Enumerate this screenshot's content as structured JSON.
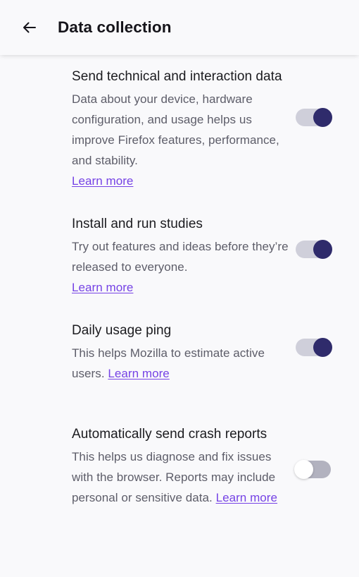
{
  "header": {
    "back_icon": "arrow-left-icon",
    "title": "Data collection"
  },
  "colors": {
    "background": "#f9f9fb",
    "title_text": "#15141a",
    "heading_text": "#1b1b1f",
    "body_text": "#5d5d69",
    "link": "#7542e5",
    "toggle_on_thumb": "#2f2b6b",
    "toggle_on_track": "#cfcfda",
    "toggle_off_thumb": "#ffffff",
    "toggle_off_track": "#b2b2bf"
  },
  "preferences": [
    {
      "title": "Send technical and interaction data",
      "description": "Data about your device, hardware configuration, and usage helps us improve Firefox features, performance, and stability.",
      "link_label": "Learn more",
      "link_inline": false,
      "toggle_state": "on",
      "toggle_label": "Send technical and interaction data toggle"
    },
    {
      "title": "Install and run studies",
      "description": "Try out features and ideas before they’re released to everyone.",
      "link_label": "Learn more",
      "link_inline": false,
      "toggle_state": "on",
      "toggle_label": "Install and run studies toggle"
    },
    {
      "title": "Daily usage ping",
      "description": "This helps Mozilla to estimate active users. ",
      "link_label": "Learn more",
      "link_inline": true,
      "toggle_state": "on",
      "toggle_label": "Daily usage ping toggle"
    },
    {
      "title": "Automatically send crash reports",
      "description": "This helps us diagnose and fix issues with the browser. Reports may include personal or sensitive data. ",
      "link_label": "Learn more",
      "link_inline": true,
      "toggle_state": "off",
      "toggle_label": "Automatically send crash reports toggle"
    }
  ]
}
